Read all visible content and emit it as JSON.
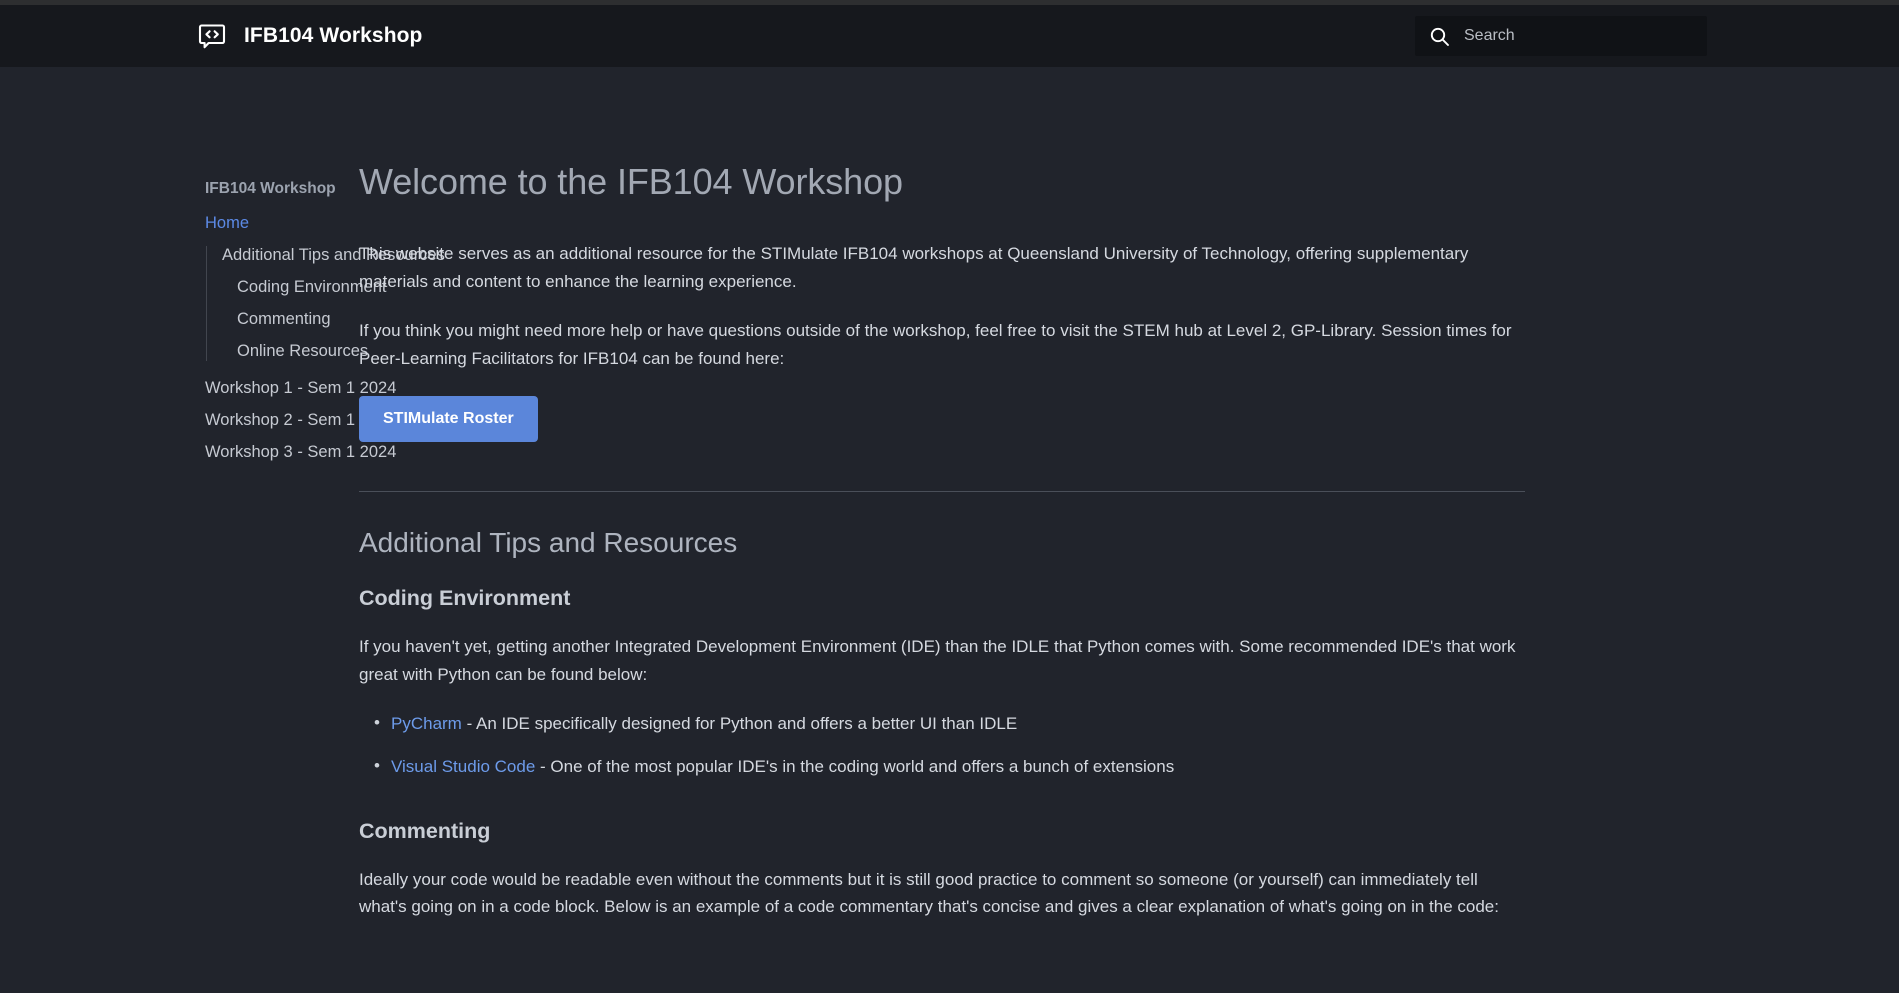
{
  "header": {
    "logo_icon": "code-speech-bubble-icon",
    "brand_title": "IFB104 Workshop",
    "search": {
      "icon": "search-icon",
      "placeholder": "Search",
      "value": ""
    }
  },
  "sidebar": {
    "title": "IFB104 Workshop",
    "home_label": "Home",
    "group": {
      "parent": "Additional Tips and Resources",
      "children": [
        "Coding Environment",
        "Commenting",
        "Online Resources"
      ]
    },
    "workshops": [
      "Workshop 1 - Sem 1 2024",
      "Workshop 2 - Sem 1 2024",
      "Workshop 3 - Sem 1 2024"
    ]
  },
  "main": {
    "page_title": "Welcome to the IFB104 Workshop",
    "intro_p1": "This website serves as an additional resource for the STIMulate IFB104 workshops at Queensland University of Technology, offering supplementary materials and content to enhance the learning experience.",
    "intro_p2": "If you think you might need more help or have questions outside of the workshop, feel free to visit the STEM hub at Level 2, GP-Library. Session times for Peer-Learning Facilitators for IFB104 can be found here:",
    "roster_button": "STIMulate Roster",
    "section_tips_heading": "Additional Tips and Resources",
    "coding_env": {
      "heading": "Coding Environment",
      "paragraph": "If you haven't yet, getting another Integrated Development Environment (IDE) than the IDLE that Python comes with. Some recommended IDE's that work great with Python can be found below:",
      "items": [
        {
          "link": "PyCharm",
          "rest": " - An IDE specifically designed for Python and offers a better UI than IDLE"
        },
        {
          "link": "Visual Studio Code",
          "rest": " - One of the most popular IDE's in the coding world and offers a bunch of extensions"
        }
      ]
    },
    "commenting": {
      "heading": "Commenting",
      "paragraph": "Ideally your code would be readable even without the comments but it is still good practice to comment so someone (or yourself) can immediately tell what's going on in a code block. Below is an example of a code commentary that's concise and gives a clear explanation of what's going on in the code:"
    }
  },
  "colors": {
    "header_bg": "#16181d",
    "body_bg": "#21242c",
    "accent_blue": "#5b86da",
    "link_blue": "#6d9bea",
    "body_text": "#d5d9e0"
  }
}
